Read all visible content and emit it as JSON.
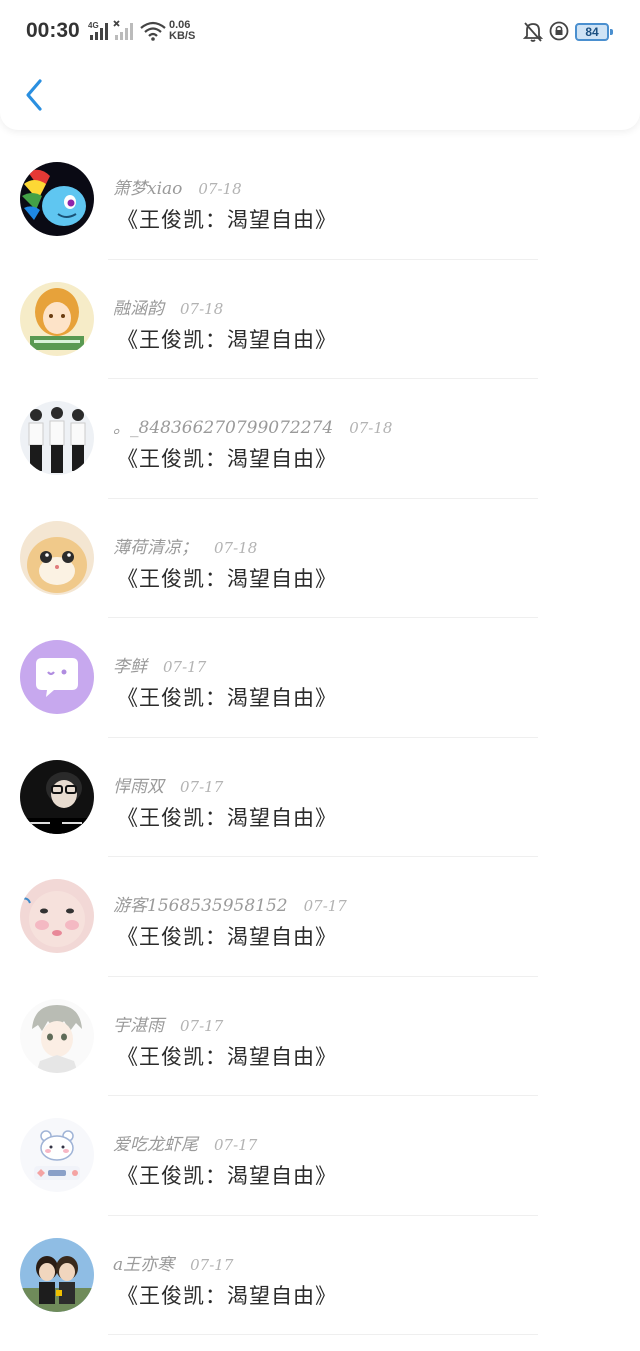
{
  "status_bar": {
    "time": "00:30",
    "network_type": "4G",
    "speed_value": "0.06",
    "speed_unit": "KB/S",
    "battery": "84"
  },
  "colors": {
    "accent": "#2a8fe0",
    "name_text": "#9a9a9a",
    "message_text": "#2b2b2b",
    "battery_fill": "#cfe3f5"
  },
  "messages": [
    {
      "name": "箫梦xiao",
      "date": "07-18",
      "text": "《王俊凯：渴望自由》",
      "avatar": "rainbow-pony"
    },
    {
      "name": "融涵韵",
      "date": "07-18",
      "text": "《王俊凯：渴望自由》",
      "avatar": "anime-girl"
    },
    {
      "name": "。_848366270799072274",
      "date": "07-18",
      "text": "《王俊凯：渴望自由》",
      "avatar": "three-boys"
    },
    {
      "name": "薄荷清凉；",
      "date": "07-18",
      "text": "《王俊凯：渴望自由》",
      "avatar": "cat"
    },
    {
      "name": "李鲜",
      "date": "07-17",
      "text": "《王俊凯：渴望自由》",
      "avatar": "chat-bubble"
    },
    {
      "name": "悍雨双",
      "date": "07-17",
      "text": "《王俊凯：渴望自由》",
      "avatar": "glasses-person"
    },
    {
      "name": "游客1568535958152",
      "date": "07-17",
      "text": "《王俊凯：渴望自由》",
      "avatar": "baby-face"
    },
    {
      "name": "宇湛雨",
      "date": "07-17",
      "text": "《王俊凯：渴望自由》",
      "avatar": "anime-boy"
    },
    {
      "name": "爱吃龙虾尾",
      "date": "07-17",
      "text": "《王俊凯：渴望自由》",
      "avatar": "cute-bear"
    },
    {
      "name": "a王亦寒",
      "date": "07-17",
      "text": "《王俊凯：渴望自由》",
      "avatar": "couple"
    }
  ]
}
